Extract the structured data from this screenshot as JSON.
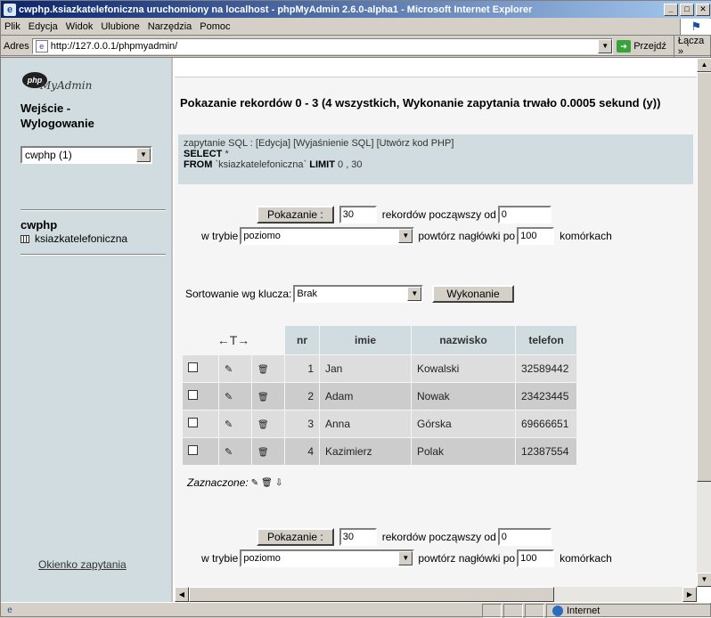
{
  "window": {
    "title": "cwphp.ksiazkatelefoniczna uruchomiony na localhost - phpMyAdmin 2.6.0-alpha1 - Microsoft Internet Explorer",
    "minimize": "_",
    "maximize": "□",
    "close": "✕"
  },
  "menubar": {
    "items": [
      "Plik",
      "Edycja",
      "Widok",
      "Ulubione",
      "Narzędzia",
      "Pomoc"
    ]
  },
  "addressbar": {
    "label": "Adres",
    "url": "http://127.0.0.1/phpmyadmin/",
    "go_label": "Przejdź",
    "links_label": "Łącza"
  },
  "sidebar": {
    "logo_php": "php",
    "logo_text": "MyAdmin",
    "login_line1": "Wejście -",
    "login_line2": "Wylogowanie",
    "db_selected": "cwphp (1)",
    "db_name": "cwphp",
    "table_name": "ksiazkatelefoniczna",
    "query_window": "Okienko zapytania"
  },
  "main": {
    "results_header": "Pokazanie rekordów 0 - 3 (4 wszystkich, Wykonanie zapytania trwało 0.0005 sekund (y))",
    "sql_prefix": "zapytanie SQL :",
    "sql_edit": "[Edycja]",
    "sql_explain": "[Wyjaśnienie SQL]",
    "sql_php": "[Utwórz kod PHP]",
    "sql_select": "SELECT",
    "sql_star": "*",
    "sql_from": "FROM",
    "sql_table": "`ksiazkatelefoniczna`",
    "sql_limit": "LIMIT",
    "sql_limit_val": "0 , 30",
    "show_button": "Pokazanie :",
    "rows_value": "30",
    "records_from": "rekordów począwszy od",
    "start_value": "0",
    "mode_label": "w trybie",
    "mode_value": "poziomo",
    "repeat_label": "powtórz nagłówki po",
    "repeat_value": "100",
    "cells_label": "komórkach",
    "sort_label": "Sortowanie wg klucza:",
    "sort_value": "Brak",
    "execute_button": "Wykonanie",
    "selected_label": "Zaznaczone:"
  },
  "table": {
    "arrows": "←T→",
    "headers": [
      "nr",
      "imie",
      "nazwisko",
      "telefon"
    ],
    "rows": [
      {
        "nr": "1",
        "imie": "Jan",
        "nazwisko": "Kowalski",
        "telefon": "32589442"
      },
      {
        "nr": "2",
        "imie": "Adam",
        "nazwisko": "Nowak",
        "telefon": "23423445"
      },
      {
        "nr": "3",
        "imie": "Anna",
        "nazwisko": "Górska",
        "telefon": "69666651"
      },
      {
        "nr": "4",
        "imie": "Kazimierz",
        "nazwisko": "Polak",
        "telefon": "12387554"
      }
    ]
  },
  "statusbar": {
    "zone": "Internet"
  }
}
